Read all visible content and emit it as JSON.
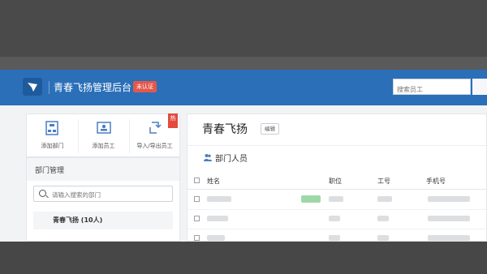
{
  "header": {
    "app_title": "青春飞扬管理后台",
    "badge": "未认证",
    "search_placeholder": "搜索员工"
  },
  "quick_actions": [
    {
      "label": "添加部门",
      "icon": "org-chart-icon"
    },
    {
      "label": "添加员工",
      "icon": "id-card-icon"
    },
    {
      "label": "导入/导出员工",
      "icon": "import-export-icon"
    }
  ],
  "hot_tag": "热",
  "department_panel": {
    "title": "部门管理",
    "search_placeholder": "请输入搜索的部门",
    "selected_item": "青春飞扬 (10人)"
  },
  "main": {
    "org_name": "青春飞扬",
    "edit_label": "编辑",
    "members_title": "部门人员",
    "columns": [
      "姓名",
      "职位",
      "工号",
      "手机号"
    ]
  },
  "colors": {
    "header_bg": "#2a6fb8",
    "badge_bg": "#e4574a",
    "accent_green": "#9fd8a8"
  }
}
